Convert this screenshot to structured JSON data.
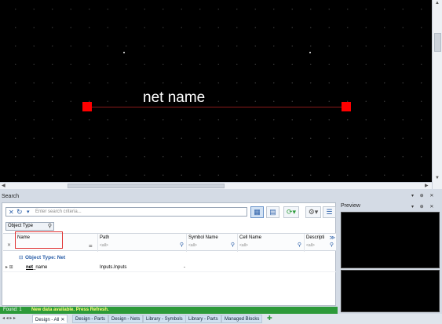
{
  "canvas": {
    "net_label": "net name"
  },
  "search": {
    "title": "Search",
    "placeholder": "Enter search criteria...",
    "object_type_label": "Object Type",
    "columns": [
      {
        "header": "Name",
        "filter": ""
      },
      {
        "header": "Path",
        "filter": "<all>"
      },
      {
        "header": "Symbol Name",
        "filter": "<all>"
      },
      {
        "header": "Cell Name",
        "filter": "<all>"
      },
      {
        "header": "Descripti",
        "filter": "<all>"
      }
    ],
    "group_label": "Object Type: Net",
    "rows": [
      {
        "name": "net_name",
        "name_bold": "net",
        "name_rest": "_name",
        "path": "Inputs.Inputs",
        "symbol": "-"
      }
    ]
  },
  "status": {
    "found": "Found: 1",
    "message": "New data available. Press Refresh."
  },
  "tabs": [
    {
      "label": "Design - All",
      "active": true
    },
    {
      "label": "Design - Parts",
      "active": false
    },
    {
      "label": "Design - Nets",
      "active": false
    },
    {
      "label": "Library - Symbols",
      "active": false
    },
    {
      "label": "Library - Parts",
      "active": false
    },
    {
      "label": "Managed Blocks",
      "active": false
    }
  ],
  "preview": {
    "title": "Preview"
  },
  "colors": {
    "pin": "#ff0000",
    "net": "#8a1a1a",
    "status_bg": "#2c9a39",
    "status_msg": "#ffff7a"
  }
}
